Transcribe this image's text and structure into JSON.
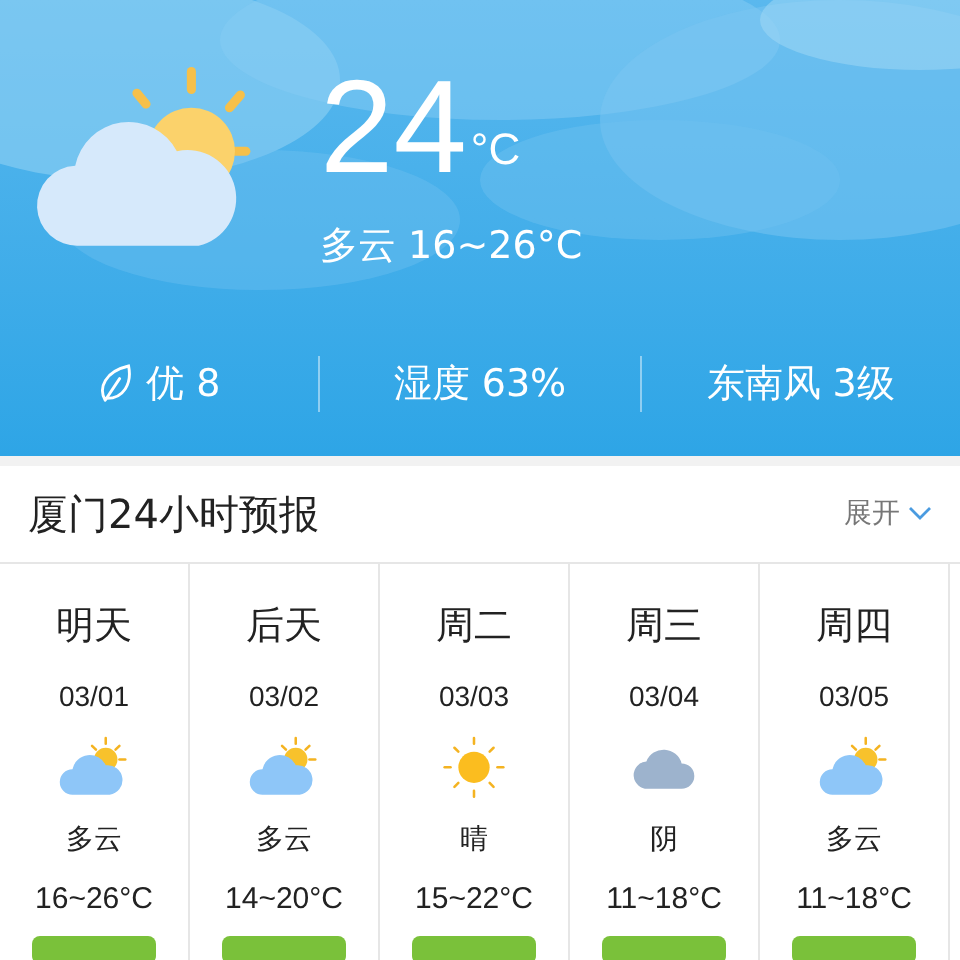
{
  "current": {
    "temperature": "24",
    "unit": "°C",
    "condition": "多云",
    "range": "16~26°C",
    "kind": "partly_cloudy"
  },
  "stats": [
    {
      "kind": "aqi",
      "text": "优 8"
    },
    {
      "kind": "plain",
      "text": "湿度 63%"
    },
    {
      "kind": "plain",
      "text": "东南风 3级"
    }
  ],
  "forecast": {
    "title": "厦门24小时预报",
    "toggle": "展开",
    "days": [
      {
        "day": "明天",
        "date": "03/01",
        "kind": "partly_cloudy",
        "condition": "多云",
        "range": "16~26°C"
      },
      {
        "day": "后天",
        "date": "03/02",
        "kind": "partly_cloudy",
        "condition": "多云",
        "range": "14~20°C"
      },
      {
        "day": "周二",
        "date": "03/03",
        "kind": "sunny",
        "condition": "晴",
        "range": "15~22°C"
      },
      {
        "day": "周三",
        "date": "03/04",
        "kind": "overcast",
        "condition": "阴",
        "range": "11~18°C"
      },
      {
        "day": "周四",
        "date": "03/05",
        "kind": "partly_cloudy",
        "condition": "多云",
        "range": "11~18°C"
      }
    ]
  }
}
